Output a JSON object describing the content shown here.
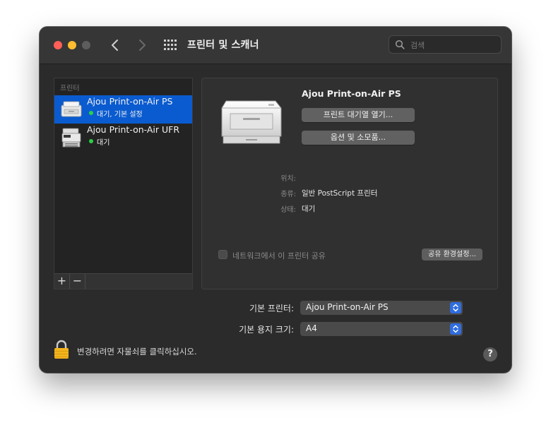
{
  "window": {
    "title": "프린터 및 스캐너",
    "search_placeholder": "검색"
  },
  "printer_list": {
    "header": "프린터",
    "items": [
      {
        "name": "Ajou Print-on-Air PS",
        "status": "대기, 기본 설정",
        "selected": true
      },
      {
        "name": "Ajou Print-on-Air UFR",
        "status": "대기",
        "selected": false
      }
    ],
    "add_label": "+",
    "remove_label": "−"
  },
  "detail": {
    "name": "Ajou Print-on-Air PS",
    "open_queue_button": "프린트 대기열 열기...",
    "options_button": "옵션 및 소모품...",
    "location_label": "위치:",
    "location_value": "",
    "kind_label": "종류:",
    "kind_value": "일반 PostScript 프린터",
    "status_label": "상태:",
    "status_value": "대기",
    "share_label": "네트워크에서 이 프린터 공유",
    "share_checked": false,
    "share_prefs_button": "공유 환경설정..."
  },
  "defaults": {
    "default_printer_label": "기본 프린터:",
    "default_printer_value": "Ajou Print-on-Air PS",
    "paper_size_label": "기본 용지 크기:",
    "paper_size_value": "A4"
  },
  "footer": {
    "lock_text": "변경하려면 자물쇠를 클릭하십시오.",
    "help_label": "?"
  },
  "colors": {
    "accent": "#0a5bd0",
    "status_green": "#2bd046",
    "window_bg": "#2b2b2b"
  }
}
